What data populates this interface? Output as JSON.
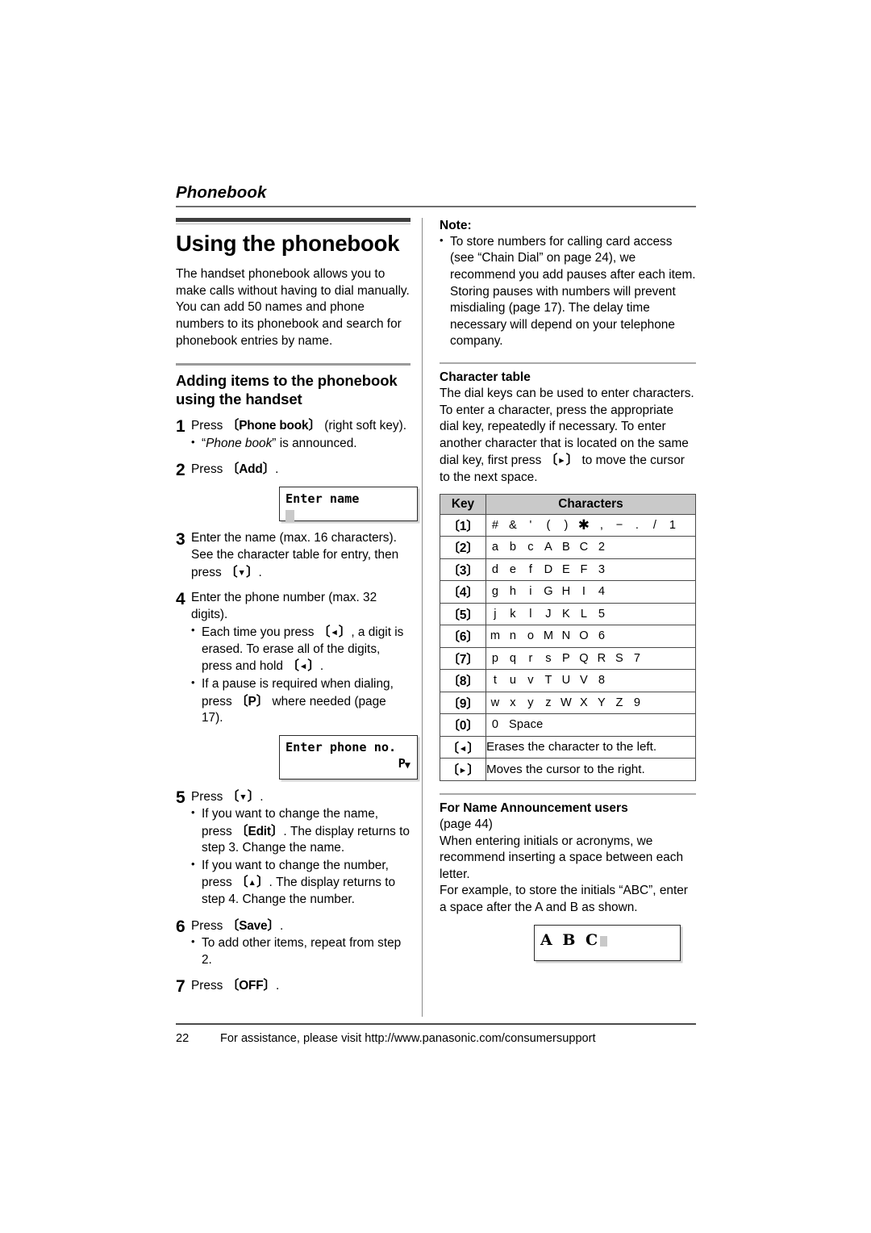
{
  "running_head": "Phonebook",
  "left": {
    "title": "Using the phonebook",
    "intro": "The handset phonebook allows you to make calls without having to dial manually. You can add 50 names and phone numbers to its phonebook and search for phonebook entries by name.",
    "subtitle": "Adding items to the phonebook using the handset",
    "steps": [
      {
        "num": "1",
        "text_before": "Press ",
        "key": "Phone book",
        "text_after": " (right soft key).",
        "bullets": [
          "“Phone book” is announced."
        ]
      },
      {
        "num": "2",
        "text_before": "Press ",
        "key": "Add",
        "text_after": "."
      },
      {
        "num": "3",
        "text": "Enter the name (max. 16 characters). See the character table for entry, then press",
        "key_glyph": "▼",
        "text_tail": "."
      },
      {
        "num": "4",
        "text": "Enter the phone number (max. 32 digits)."
      },
      {
        "num": "5",
        "text_before": "Press ",
        "key_glyph": "▼",
        "text_after": "."
      },
      {
        "num": "6",
        "text_before": "Press ",
        "key": "Save",
        "text_after": "."
      },
      {
        "num": "7",
        "text_before": "Press ",
        "key": "OFF",
        "text_after": "."
      }
    ],
    "step4_bullets": [
      {
        "a": "Each time you press ",
        "glyph": "◄",
        "b": ", a digit is erased. To erase all of the digits, press and hold ",
        "glyph2": "◄",
        "c": "."
      },
      {
        "a": "If a pause is required when dialing, press ",
        "keyp": "P",
        "b": " where needed (page 17)."
      }
    ],
    "step5_bullets": [
      {
        "a": "If you want to change the name, press ",
        "key": "Edit",
        "b": ". The display returns to step 3. Change the name."
      },
      {
        "a": "If you want to change the number, press ",
        "glyph": "▲",
        "b": ". The display returns to step 4. Change the number."
      }
    ],
    "step6_bullet": "To add other items, repeat from step 2.",
    "lcd_enter_name": "Enter name",
    "lcd_enter_phone": "Enter phone no.",
    "lcd_enter_phone_p": "P"
  },
  "right": {
    "note_label": "Note:",
    "note_bullets": [
      "To store numbers for calling card access (see “Chain Dial” on page 24), we recommend you add pauses after each item. Storing pauses with numbers will prevent misdialing (page 17). The delay time necessary will depend on your telephone company."
    ],
    "char_table_heading": "Character table",
    "char_table_intro_a": "The dial keys can be used to enter characters. To enter a character, press the appropriate dial key, repeatedly if necessary. To enter another character that is located on the same dial key, first press ",
    "char_table_intro_glyph": "►",
    "char_table_intro_b": " to move the cursor to the next space.",
    "table": {
      "headers": [
        "Key",
        "Characters"
      ],
      "rows": [
        {
          "key": "1",
          "chars": [
            "#",
            "&",
            "'",
            "(",
            ")",
            "✱",
            ",",
            "−",
            ".",
            "/",
            "1"
          ]
        },
        {
          "key": "2",
          "chars": [
            "a",
            "b",
            "c",
            "A",
            "B",
            "C",
            "2"
          ]
        },
        {
          "key": "3",
          "chars": [
            "d",
            "e",
            "f",
            "D",
            "E",
            "F",
            "3"
          ]
        },
        {
          "key": "4",
          "chars": [
            "g",
            "h",
            "i",
            "G",
            "H",
            "I",
            "4"
          ]
        },
        {
          "key": "5",
          "chars": [
            "j",
            "k",
            "l",
            "J",
            "K",
            "L",
            "5"
          ]
        },
        {
          "key": "6",
          "chars": [
            "m",
            "n",
            "o",
            "M",
            "N",
            "O",
            "6"
          ]
        },
        {
          "key": "7",
          "chars": [
            "p",
            "q",
            "r",
            "s",
            "P",
            "Q",
            "R",
            "S",
            "7"
          ]
        },
        {
          "key": "8",
          "chars": [
            "t",
            "u",
            "v",
            "T",
            "U",
            "V",
            "8"
          ]
        },
        {
          "key": "9",
          "chars": [
            "w",
            "x",
            "y",
            "z",
            "W",
            "X",
            "Y",
            "Z",
            "9"
          ]
        },
        {
          "key": "0",
          "chars": [
            "0",
            "Space"
          ]
        }
      ],
      "span_rows": [
        {
          "key": "◄",
          "text": "Erases the character to the left."
        },
        {
          "key": "►",
          "text": "Moves the cursor to the right."
        }
      ]
    },
    "name_ann_heading": "For Name Announcement users",
    "name_ann_page": "(page 44)",
    "name_ann_body_1": "When entering initials or acronyms, we recommend inserting a space between each letter.",
    "name_ann_body_2": "For example, to store the initials “ABC”, enter a space after the A and B as shown.",
    "lcd_abc": "A B C"
  },
  "footer": {
    "page_number": "22",
    "text": "For assistance, please visit http://www.panasonic.com/consumersupport"
  }
}
